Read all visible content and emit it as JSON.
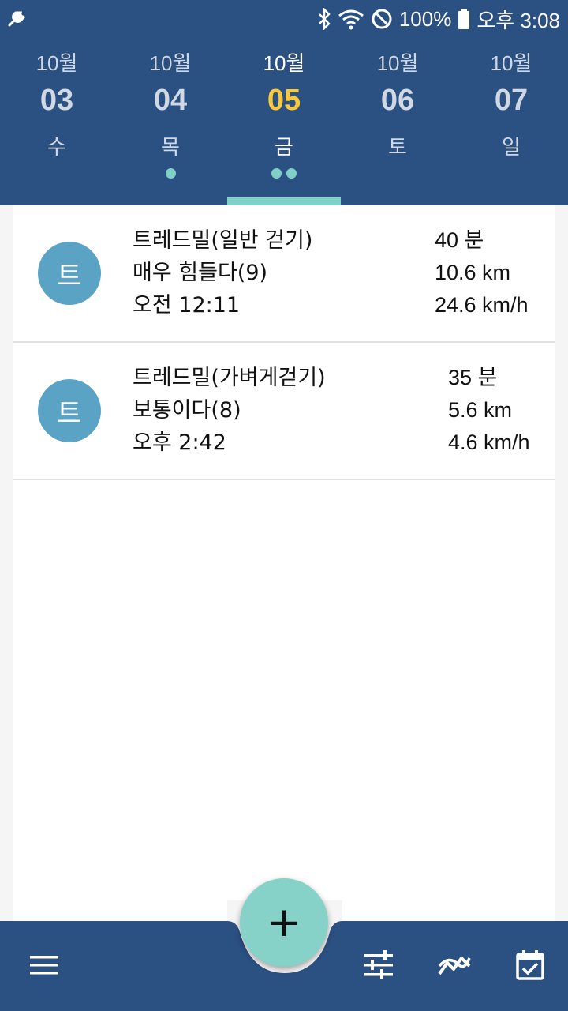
{
  "status_bar": {
    "battery": "100%",
    "time": "오후 3:08",
    "icons": [
      "wrench-icon",
      "bluetooth-icon",
      "wifi-icon",
      "do-not-disturb-icon",
      "battery-icon"
    ]
  },
  "dates": [
    {
      "month": "10월",
      "day": "03",
      "weekday": "수",
      "dots": 0
    },
    {
      "month": "10월",
      "day": "04",
      "weekday": "목",
      "dots": 1
    },
    {
      "month": "10월",
      "day": "05",
      "weekday": "금",
      "dots": 2
    },
    {
      "month": "10월",
      "day": "06",
      "weekday": "토",
      "dots": 0
    },
    {
      "month": "10월",
      "day": "07",
      "weekday": "일",
      "dots": 0
    }
  ],
  "selected_index": 2,
  "workouts": [
    {
      "avatar": "트",
      "name": "트레드밀(일반 걷기)",
      "intensity": "매우 힘들다(9)",
      "time": "오전 12:11",
      "duration": "40 분",
      "distance": "10.6 km",
      "speed": "24.6 km/h"
    },
    {
      "avatar": "트",
      "name": "트레드밀(가벼게걷기)",
      "intensity": "보통이다(8)",
      "time": "오후 2:42",
      "duration": "35 분",
      "distance": "5.6 km",
      "speed": "4.6 km/h"
    }
  ],
  "fab": {
    "label": "+"
  },
  "bottom_nav": {
    "icons": [
      "menu-icon",
      "filter-sliders-icon",
      "trend-chart-icon",
      "calendar-check-icon"
    ]
  },
  "colors": {
    "primary": "#2b5082",
    "accent": "#86d2c9",
    "selected_day": "#f9c93a",
    "avatar": "#5aa3c5"
  }
}
